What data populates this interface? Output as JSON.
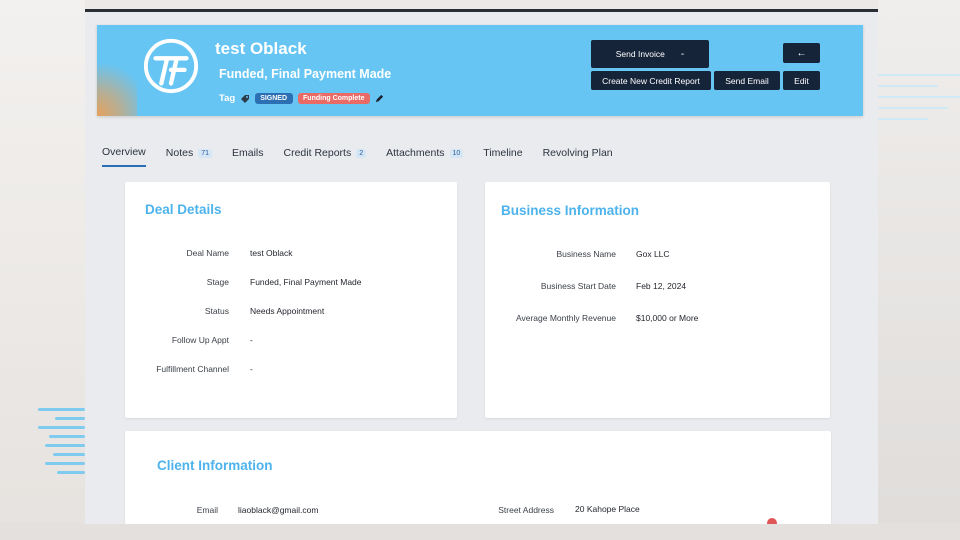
{
  "header": {
    "title": "test Oblack",
    "stage": "Funded, Final Payment Made",
    "tag_label": "Tag",
    "badges": [
      "SIGNED",
      "Funding Complete"
    ],
    "buttons": {
      "send_invoice": "Send Invoice",
      "send_invoice_caret": "-",
      "create_credit_report": "Create New Credit Report",
      "send_email": "Send Email",
      "back": "←",
      "edit": "Edit"
    }
  },
  "tabs": [
    {
      "label": "Overview",
      "count": null,
      "active": true
    },
    {
      "label": "Notes",
      "count": "71"
    },
    {
      "label": "Emails",
      "count": null
    },
    {
      "label": "Credit Reports",
      "count": "2"
    },
    {
      "label": "Attachments",
      "count": "10"
    },
    {
      "label": "Timeline",
      "count": null
    },
    {
      "label": "Revolving Plan",
      "count": null
    }
  ],
  "deal_details": {
    "title": "Deal Details",
    "rows": [
      {
        "label": "Deal Name",
        "value": "test Oblack"
      },
      {
        "label": "Stage",
        "value": "Funded, Final Payment Made"
      },
      {
        "label": "Status",
        "value": "Needs Appointment"
      },
      {
        "label": "Follow Up Appt",
        "value": "-"
      },
      {
        "label": "Fulfillment Channel",
        "value": "-"
      }
    ]
  },
  "business_information": {
    "title": "Business Information",
    "rows": [
      {
        "label": "Business Name",
        "value": "Gox LLC"
      },
      {
        "label": "Business Start Date",
        "value": "Feb 12, 2024"
      },
      {
        "label": "Average Monthly Revenue",
        "value": "$10,000 or More"
      }
    ]
  },
  "client_information": {
    "title": "Client Information",
    "email_label": "Email",
    "email_value": "liaoblack@gmail.com",
    "street_label": "Street Address",
    "street_value": "20 Kahope Place"
  },
  "colors": {
    "header_bg": "#67c5f3",
    "button_bg": "#16243a",
    "section_title": "#4db3ec",
    "badge_signed": "#2d6fb3",
    "badge_funding": "#ea6b66",
    "active_tab_underline": "#2a6fb5"
  },
  "icons": [
    "logo-tf",
    "tag-icon",
    "pencil-icon",
    "arrow-left-icon"
  ]
}
